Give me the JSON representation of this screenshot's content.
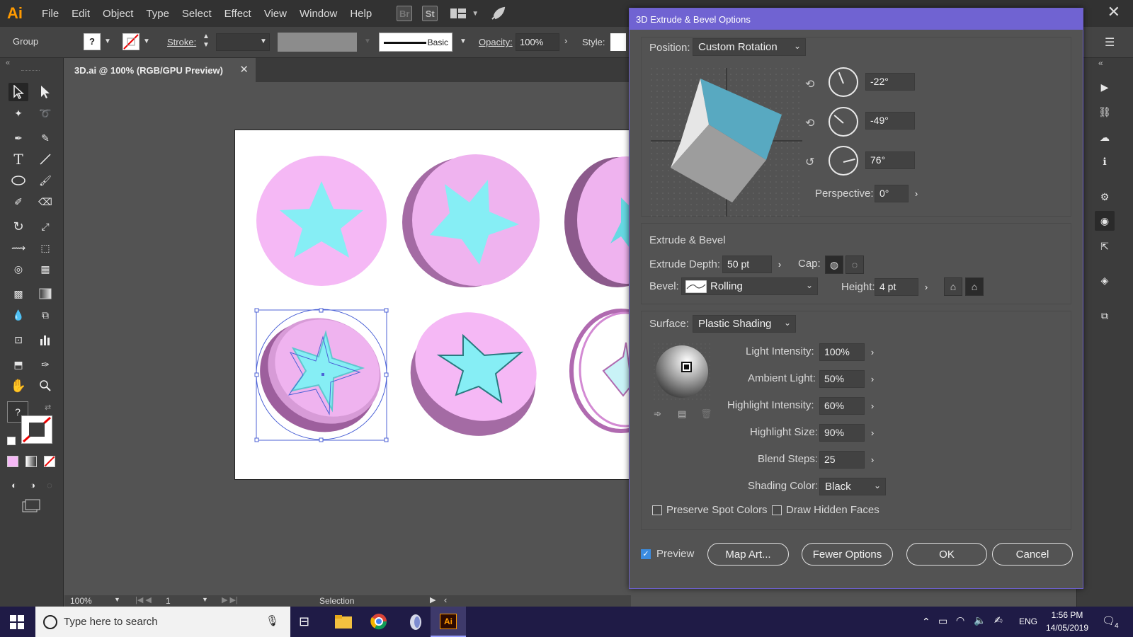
{
  "app": {
    "logo": "Ai",
    "menu": [
      "File",
      "Edit",
      "Object",
      "Type",
      "Select",
      "Effect",
      "View",
      "Window",
      "Help"
    ],
    "bridge_label": "Br",
    "stock_label": "St"
  },
  "controlbar": {
    "selection_type": "Group",
    "stroke_label": "Stroke:",
    "brush_label": "Basic",
    "opacity_label": "Opacity:",
    "opacity_value": "100%",
    "style_label": "Style:"
  },
  "document": {
    "tab_title": "3D.ai @ 100% (RGB/GPU Preview)",
    "close": "✕"
  },
  "statusbar": {
    "zoom": "100%",
    "page": "1",
    "tool_name": "Selection"
  },
  "dialog": {
    "title": "3D Extrude & Bevel Options",
    "position_label": "Position:",
    "position_value": "Custom Rotation",
    "rot_x": "-22°",
    "rot_y": "-49°",
    "rot_z": "76°",
    "perspective_label": "Perspective:",
    "perspective_value": "0°",
    "extrude_section": "Extrude & Bevel",
    "extrude_depth_label": "Extrude Depth:",
    "extrude_depth_value": "50 pt",
    "cap_label": "Cap:",
    "bevel_label": "Bevel:",
    "bevel_value": "Rolling",
    "height_label": "Height:",
    "height_value": "4 pt",
    "surface_label": "Surface:",
    "surface_value": "Plastic Shading",
    "light_intensity_label": "Light Intensity:",
    "light_intensity_value": "100%",
    "ambient_light_label": "Ambient Light:",
    "ambient_light_value": "50%",
    "highlight_intensity_label": "Highlight Intensity:",
    "highlight_intensity_value": "60%",
    "highlight_size_label": "Highlight Size:",
    "highlight_size_value": "90%",
    "blend_steps_label": "Blend Steps:",
    "blend_steps_value": "25",
    "shading_color_label": "Shading Color:",
    "shading_color_value": "Black",
    "preserve_spot_label": "Preserve Spot Colors",
    "draw_hidden_label": "Draw Hidden Faces",
    "preview_label": "Preview",
    "preview_checked": true,
    "map_art_label": "Map Art...",
    "fewer_options_label": "Fewer Options",
    "ok_label": "OK",
    "cancel_label": "Cancel"
  },
  "taskbar": {
    "search_placeholder": "Type here to search",
    "lang": "ENG",
    "time": "1:56 PM",
    "date": "14/05/2019",
    "notifications": "4"
  },
  "colors": {
    "dialog_title": "#7063d2",
    "pink_face": "#f5b8f5",
    "star_cyan": "#86eef5",
    "cube_blue": "#58a9c1",
    "taskbar": "#1f1b46",
    "ai_orange": "#ff9a00"
  }
}
